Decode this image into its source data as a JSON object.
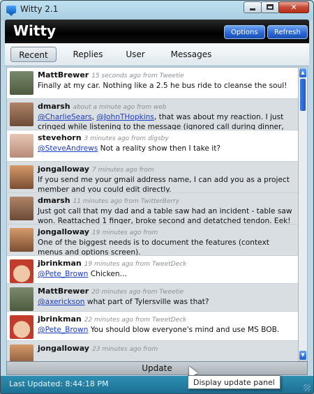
{
  "window": {
    "title": "Witty 2.1"
  },
  "header": {
    "brand": "Witty",
    "options_label": "Options",
    "refresh_label": "Refresh"
  },
  "tabs": [
    {
      "label": "Recent",
      "active": true
    },
    {
      "label": "Replies",
      "active": false
    },
    {
      "label": "User",
      "active": false
    },
    {
      "label": "Messages",
      "active": false
    }
  ],
  "tweets": [
    {
      "user": "MattBrewer",
      "meta": "15 seconds ago from Tweetie",
      "text": "Finally at my car. Nothing like a 2.5 he bus ride to cleanse the soul!",
      "mentions": []
    },
    {
      "user": "dmarsh",
      "meta": "about a minute ago from web",
      "pre": "",
      "mentions": [
        "@CharlieSears",
        "@JohnTHopkins"
      ],
      "text": "that was about my reaction. I just cringed while listening to the message (ignored call during dinner, oops)"
    },
    {
      "user": "stevehorn",
      "meta": "3 minutes ago from digsby",
      "mentions": [
        "@SteveAndrews"
      ],
      "text": "Not a reality show then I take it?"
    },
    {
      "user": "jongalloway",
      "meta": "7 minutes ago from",
      "mentions": [],
      "text": "If you send me your gmail address name, I can add you as a project member and you could edit directly."
    },
    {
      "user": "dmarsh",
      "meta": "11 minutes ago from TwitterBerry",
      "mentions": [],
      "text": "Just got call that my dad and a table saw had an incident - table saw won. Reattached 1 finger, broke second and detatched tendon. Eek!"
    },
    {
      "user": "jongalloway",
      "meta": "19 minutes ago from",
      "mentions": [],
      "text": "One of the biggest needs is to document the features (context menus and options screen)."
    },
    {
      "user": "jbrinkman",
      "meta": "19 minutes ago from TweetDeck",
      "mentions": [
        "@Pete_Brown"
      ],
      "text": "Chicken..."
    },
    {
      "user": "MattBrewer",
      "meta": "20 minutes ago from Tweetie",
      "mentions": [
        "@axerickson"
      ],
      "text": "what part of Tylersville was that?"
    },
    {
      "user": "jbrinkman",
      "meta": "22 minutes ago from TweetDeck",
      "mentions": [
        "@Pete_Brown"
      ],
      "text": "You should blow everyone's mind and use  MS BOB."
    },
    {
      "user": "jongalloway",
      "meta": "23 minutes ago from",
      "mentions": [],
      "text": ""
    }
  ],
  "update": {
    "label": "Update",
    "tooltip": "Display update panel"
  },
  "status": {
    "text": "Last Updated: 8:44:18 PM"
  },
  "colors": {
    "accent": "#2c69d8",
    "header_bg": "#000000",
    "status_bg": "#1b6f93",
    "mention": "#1a3cc7"
  }
}
